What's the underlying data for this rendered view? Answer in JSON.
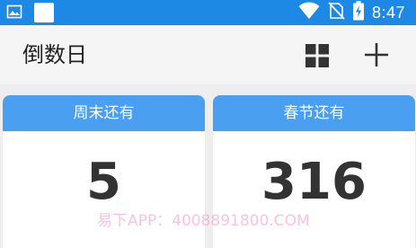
{
  "status_bar": {
    "time": "8:47",
    "icons": [
      "image-icon",
      "notification-icon",
      "wifi-icon",
      "no-sim-icon",
      "battery-charging-icon"
    ]
  },
  "app_bar": {
    "title": "倒数日",
    "actions": [
      "grid-view-icon",
      "add-icon"
    ]
  },
  "cards": [
    {
      "title": "周末还有",
      "count": "5"
    },
    {
      "title": "春节还有",
      "count": "316"
    }
  ],
  "watermark": "易下APP：4008891800.COM",
  "colors": {
    "status_bar": "#1e88e5",
    "card_header": "#4a9ff0",
    "background": "#eeeeee",
    "app_bar": "#f5f5f5"
  }
}
